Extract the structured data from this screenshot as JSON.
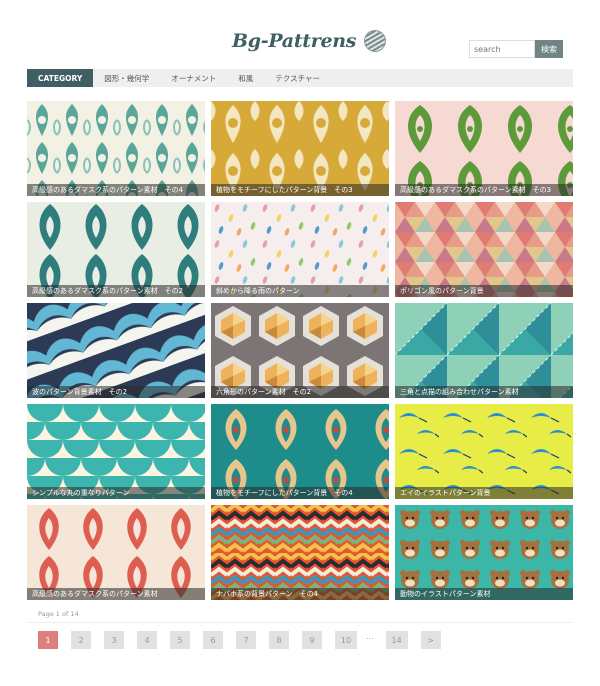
{
  "site": {
    "title": "Bg-Pattrens"
  },
  "search": {
    "placeholder": "search",
    "button": "検索"
  },
  "nav": [
    {
      "label": "CATEGORY",
      "active": true
    },
    {
      "label": "図形・幾何学"
    },
    {
      "label": "オーナメント"
    },
    {
      "label": "和風"
    },
    {
      "label": "テクスチャー"
    }
  ],
  "tiles": [
    {
      "caption": "高級感のあるダマスク系のパターン素材　その4",
      "pattern": "damask-teal-on-cream",
      "colors": [
        "#f2f1e3",
        "#5aa79a"
      ]
    },
    {
      "caption": "植物をモチーフにしたパターン背景　その3",
      "pattern": "damask-cream-on-mustard",
      "colors": [
        "#d7a938",
        "#f3e7c2"
      ]
    },
    {
      "caption": "高級感のあるダマスク系のパターン素材　その3",
      "pattern": "damask-green-on-pink",
      "colors": [
        "#f6d9d3",
        "#5d9a3a"
      ]
    },
    {
      "caption": "高級感のあるダマスク系のパターン素材　その2",
      "pattern": "damask-teal-on-cream",
      "colors": [
        "#e9eee5",
        "#2f7d7d"
      ]
    },
    {
      "caption": "斜めから降る雨のパターン",
      "pattern": "rain-drops",
      "colors": [
        "#f5eeec"
      ]
    },
    {
      "caption": "ポリゴン風のパターン背景",
      "pattern": "polygon-triangles",
      "colors": [
        "#e07b73",
        "#f0b7a0"
      ]
    },
    {
      "caption": "波のパターン背景素材　その2",
      "pattern": "waves",
      "colors": [
        "#2d3a55",
        "#62b8d4"
      ]
    },
    {
      "caption": "六角形のパターン素材　その2",
      "pattern": "hexagons",
      "colors": [
        "#7c7576",
        "#eeb25a"
      ]
    },
    {
      "caption": "三角と点描の組み合わせパターン素材",
      "pattern": "triangles-dotted",
      "colors": [
        "#3aa9a6",
        "#8fd0b9"
      ]
    },
    {
      "caption": "シンプルな丸の重なりパターン",
      "pattern": "scales",
      "colors": [
        "#fbf5e2",
        "#3bb5ad"
      ]
    },
    {
      "caption": "植物をモチーフにしたパターン背景　その4",
      "pattern": "damask-on-teal",
      "colors": [
        "#1e8c8a",
        "#e6c68c"
      ]
    },
    {
      "caption": "エイのイラストパターン背景",
      "pattern": "manta-rays",
      "colors": [
        "#e7ec47",
        "#2a8fcf"
      ]
    },
    {
      "caption": "高級感のあるダマスク系のパターン素材",
      "pattern": "damask-red-on-cream",
      "colors": [
        "#f6e6d8",
        "#df5e52"
      ]
    },
    {
      "caption": "ナバホ系の背景パターン　その4",
      "pattern": "navajo-zigzag",
      "colors": [
        "#e2572e",
        "#f0c24e"
      ]
    },
    {
      "caption": "動物のイラストパターン素材",
      "pattern": "animal-faces",
      "colors": [
        "#3cb6a6",
        "#a7703c"
      ]
    }
  ],
  "pagination": {
    "info": "Page 1 of 14",
    "current": "1",
    "pages": [
      "2",
      "3",
      "4",
      "5",
      "6",
      "7",
      "8",
      "9",
      "10"
    ],
    "ellipsis": "...",
    "last": "14",
    "next": ">"
  }
}
